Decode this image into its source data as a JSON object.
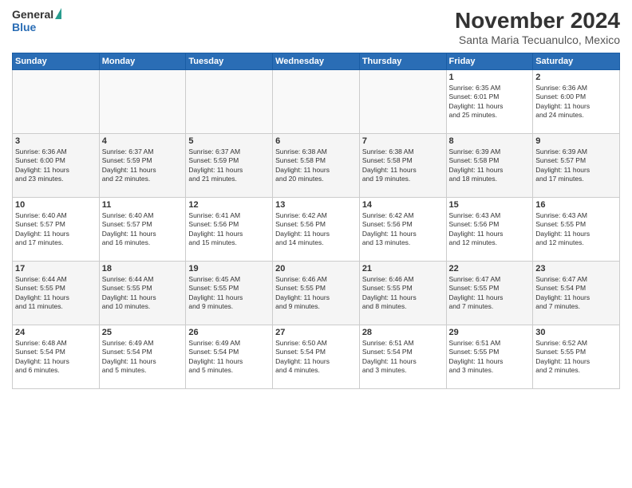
{
  "header": {
    "logo_general": "General",
    "logo_blue": "Blue",
    "title": "November 2024",
    "subtitle": "Santa Maria Tecuanulco, Mexico"
  },
  "days_of_week": [
    "Sunday",
    "Monday",
    "Tuesday",
    "Wednesday",
    "Thursday",
    "Friday",
    "Saturday"
  ],
  "weeks": [
    [
      {
        "day": "",
        "info": ""
      },
      {
        "day": "",
        "info": ""
      },
      {
        "day": "",
        "info": ""
      },
      {
        "day": "",
        "info": ""
      },
      {
        "day": "",
        "info": ""
      },
      {
        "day": "1",
        "info": "Sunrise: 6:35 AM\nSunset: 6:01 PM\nDaylight: 11 hours\nand 25 minutes."
      },
      {
        "day": "2",
        "info": "Sunrise: 6:36 AM\nSunset: 6:00 PM\nDaylight: 11 hours\nand 24 minutes."
      }
    ],
    [
      {
        "day": "3",
        "info": "Sunrise: 6:36 AM\nSunset: 6:00 PM\nDaylight: 11 hours\nand 23 minutes."
      },
      {
        "day": "4",
        "info": "Sunrise: 6:37 AM\nSunset: 5:59 PM\nDaylight: 11 hours\nand 22 minutes."
      },
      {
        "day": "5",
        "info": "Sunrise: 6:37 AM\nSunset: 5:59 PM\nDaylight: 11 hours\nand 21 minutes."
      },
      {
        "day": "6",
        "info": "Sunrise: 6:38 AM\nSunset: 5:58 PM\nDaylight: 11 hours\nand 20 minutes."
      },
      {
        "day": "7",
        "info": "Sunrise: 6:38 AM\nSunset: 5:58 PM\nDaylight: 11 hours\nand 19 minutes."
      },
      {
        "day": "8",
        "info": "Sunrise: 6:39 AM\nSunset: 5:58 PM\nDaylight: 11 hours\nand 18 minutes."
      },
      {
        "day": "9",
        "info": "Sunrise: 6:39 AM\nSunset: 5:57 PM\nDaylight: 11 hours\nand 17 minutes."
      }
    ],
    [
      {
        "day": "10",
        "info": "Sunrise: 6:40 AM\nSunset: 5:57 PM\nDaylight: 11 hours\nand 17 minutes."
      },
      {
        "day": "11",
        "info": "Sunrise: 6:40 AM\nSunset: 5:57 PM\nDaylight: 11 hours\nand 16 minutes."
      },
      {
        "day": "12",
        "info": "Sunrise: 6:41 AM\nSunset: 5:56 PM\nDaylight: 11 hours\nand 15 minutes."
      },
      {
        "day": "13",
        "info": "Sunrise: 6:42 AM\nSunset: 5:56 PM\nDaylight: 11 hours\nand 14 minutes."
      },
      {
        "day": "14",
        "info": "Sunrise: 6:42 AM\nSunset: 5:56 PM\nDaylight: 11 hours\nand 13 minutes."
      },
      {
        "day": "15",
        "info": "Sunrise: 6:43 AM\nSunset: 5:56 PM\nDaylight: 11 hours\nand 12 minutes."
      },
      {
        "day": "16",
        "info": "Sunrise: 6:43 AM\nSunset: 5:55 PM\nDaylight: 11 hours\nand 12 minutes."
      }
    ],
    [
      {
        "day": "17",
        "info": "Sunrise: 6:44 AM\nSunset: 5:55 PM\nDaylight: 11 hours\nand 11 minutes."
      },
      {
        "day": "18",
        "info": "Sunrise: 6:44 AM\nSunset: 5:55 PM\nDaylight: 11 hours\nand 10 minutes."
      },
      {
        "day": "19",
        "info": "Sunrise: 6:45 AM\nSunset: 5:55 PM\nDaylight: 11 hours\nand 9 minutes."
      },
      {
        "day": "20",
        "info": "Sunrise: 6:46 AM\nSunset: 5:55 PM\nDaylight: 11 hours\nand 9 minutes."
      },
      {
        "day": "21",
        "info": "Sunrise: 6:46 AM\nSunset: 5:55 PM\nDaylight: 11 hours\nand 8 minutes."
      },
      {
        "day": "22",
        "info": "Sunrise: 6:47 AM\nSunset: 5:55 PM\nDaylight: 11 hours\nand 7 minutes."
      },
      {
        "day": "23",
        "info": "Sunrise: 6:47 AM\nSunset: 5:54 PM\nDaylight: 11 hours\nand 7 minutes."
      }
    ],
    [
      {
        "day": "24",
        "info": "Sunrise: 6:48 AM\nSunset: 5:54 PM\nDaylight: 11 hours\nand 6 minutes."
      },
      {
        "day": "25",
        "info": "Sunrise: 6:49 AM\nSunset: 5:54 PM\nDaylight: 11 hours\nand 5 minutes."
      },
      {
        "day": "26",
        "info": "Sunrise: 6:49 AM\nSunset: 5:54 PM\nDaylight: 11 hours\nand 5 minutes."
      },
      {
        "day": "27",
        "info": "Sunrise: 6:50 AM\nSunset: 5:54 PM\nDaylight: 11 hours\nand 4 minutes."
      },
      {
        "day": "28",
        "info": "Sunrise: 6:51 AM\nSunset: 5:54 PM\nDaylight: 11 hours\nand 3 minutes."
      },
      {
        "day": "29",
        "info": "Sunrise: 6:51 AM\nSunset: 5:55 PM\nDaylight: 11 hours\nand 3 minutes."
      },
      {
        "day": "30",
        "info": "Sunrise: 6:52 AM\nSunset: 5:55 PM\nDaylight: 11 hours\nand 2 minutes."
      }
    ]
  ]
}
